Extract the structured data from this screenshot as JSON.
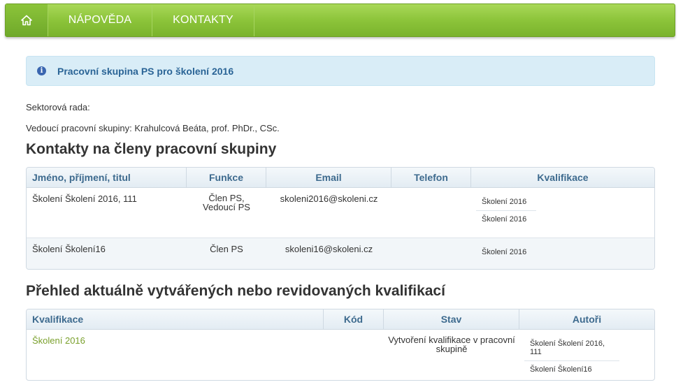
{
  "nav": {
    "home_icon": "home-icon",
    "items": [
      "NÁPOVĚDA",
      "KONTAKTY"
    ]
  },
  "alert": {
    "icon": "info-icon",
    "text": "Pracovní skupina PS pro školení 2016"
  },
  "info": {
    "sector": "Sektorová rada:",
    "leader": "Vedoucí pracovní skupiny: Krahulcová Beáta, prof. PhDr., CSc."
  },
  "members": {
    "heading": "Kontakty na členy pracovní skupiny",
    "columns": [
      "Jméno, příjmení, titul",
      "Funkce",
      "Email",
      "Telefon",
      "Kvalifikace"
    ],
    "rows": [
      {
        "name": "Školení Školení 2016, 111",
        "function": [
          "Člen PS,",
          "Vedoucí PS"
        ],
        "email": "skoleni2016@skoleni.cz",
        "phone": "",
        "qualifications": [
          "Školení 2016",
          "Školení 2016"
        ]
      },
      {
        "name": "Školení Školení16",
        "function": [
          "Člen PS"
        ],
        "email": "skoleni16@skoleni.cz",
        "phone": "",
        "qualifications": [
          "Školení 2016"
        ]
      }
    ]
  },
  "overview": {
    "heading": "Přehled aktuálně vytvářených nebo revidovaných kvalifikací",
    "columns": [
      "Kvalifikace",
      "Kód",
      "Stav",
      "Autoři"
    ],
    "rows": [
      {
        "qualification": "Školení 2016",
        "code": "",
        "status": [
          "Vytvoření kvalifikace v pracovní",
          "skupině"
        ],
        "authors": [
          "Školení Školení 2016, 111",
          "Školení Školení16"
        ]
      }
    ]
  },
  "colors": {
    "nav_green": "#8cc43a",
    "alert_bg": "#d9edf7",
    "alert_text": "#2a6496",
    "header_text": "#3d6a8e",
    "link_green": "#7aa02c"
  }
}
